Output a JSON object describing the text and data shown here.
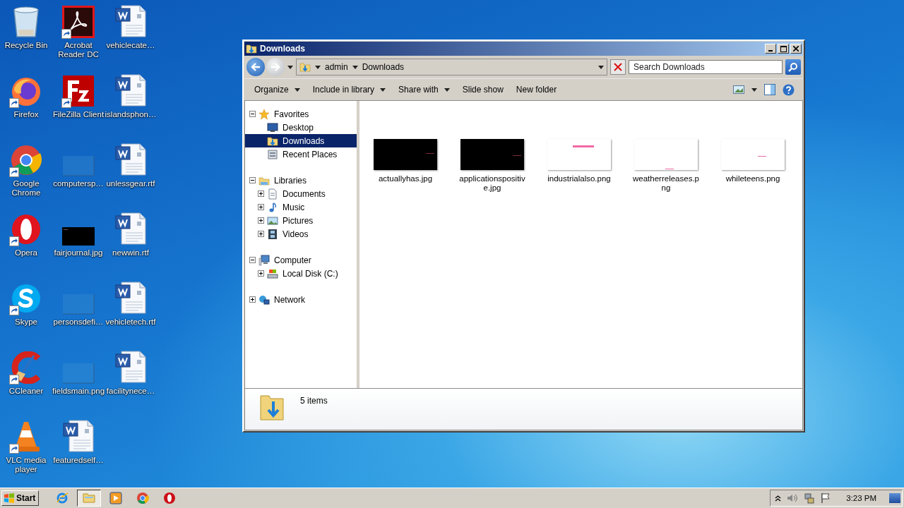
{
  "desktop": {
    "icons": [
      {
        "label": "Recycle Bin",
        "shortcut": false
      },
      {
        "label": "Firefox",
        "shortcut": true
      },
      {
        "label": "Google Chrome",
        "shortcut": true
      },
      {
        "label": "Opera",
        "shortcut": true
      },
      {
        "label": "Skype",
        "shortcut": true
      },
      {
        "label": "CCleaner",
        "shortcut": true
      },
      {
        "label": "VLC media player",
        "shortcut": true
      },
      {
        "label": "Acrobat Reader DC",
        "shortcut": true
      },
      {
        "label": "FileZilla Client",
        "shortcut": true
      },
      {
        "label": "computersp…",
        "shortcut": false
      },
      {
        "label": "fairjournal.jpg",
        "shortcut": false
      },
      {
        "label": "personsdefi…",
        "shortcut": false
      },
      {
        "label": "fieldsmain.png",
        "shortcut": false
      },
      {
        "label": "featuredself…",
        "shortcut": false
      },
      {
        "label": "vehiclecate…",
        "shortcut": false
      },
      {
        "label": "islandsphon…",
        "shortcut": false
      },
      {
        "label": "unlessgear.rtf",
        "shortcut": false
      },
      {
        "label": "newwin.rtf",
        "shortcut": false
      },
      {
        "label": "vehicletech.rtf",
        "shortcut": false
      },
      {
        "label": "facilitynece…",
        "shortcut": false
      }
    ]
  },
  "window": {
    "title": "Downloads",
    "address": {
      "crumbs": [
        "admin",
        "Downloads"
      ]
    },
    "search": {
      "placeholder": "Search Downloads"
    },
    "toolbar": [
      {
        "label": "Organize",
        "has_menu": true
      },
      {
        "label": "Include in library",
        "has_menu": true
      },
      {
        "label": "Share with",
        "has_menu": true
      },
      {
        "label": "Slide show",
        "has_menu": false
      },
      {
        "label": "New folder",
        "has_menu": false
      }
    ],
    "nav": [
      {
        "label": "Favorites",
        "expanded": true,
        "children": [
          {
            "label": "Desktop",
            "selected": false
          },
          {
            "label": "Downloads",
            "selected": true
          },
          {
            "label": "Recent Places",
            "selected": false
          }
        ]
      },
      {
        "label": "Libraries",
        "expanded": true,
        "children": [
          {
            "label": "Documents",
            "selected": false,
            "expanded": false
          },
          {
            "label": "Music",
            "selected": false,
            "expanded": false
          },
          {
            "label": "Pictures",
            "selected": false,
            "expanded": false
          },
          {
            "label": "Videos",
            "selected": false,
            "expanded": false
          }
        ]
      },
      {
        "label": "Computer",
        "expanded": true,
        "children": [
          {
            "label": "Local Disk (C:)",
            "selected": false,
            "expanded": false
          }
        ]
      },
      {
        "label": "Network",
        "expanded": false
      }
    ],
    "files": [
      {
        "name": "actuallyhas.jpg"
      },
      {
        "name": "applicationspositive.jpg"
      },
      {
        "name": "industrialalso.png"
      },
      {
        "name": "weatherreleases.png"
      },
      {
        "name": "whileteens.png"
      }
    ],
    "details": {
      "count": "5 items"
    }
  },
  "taskbar": {
    "start": "Start",
    "apps": [
      {
        "active": false
      },
      {
        "active": true
      },
      {
        "active": false
      },
      {
        "active": false
      },
      {
        "active": false
      }
    ],
    "clock": "3:23 PM"
  }
}
